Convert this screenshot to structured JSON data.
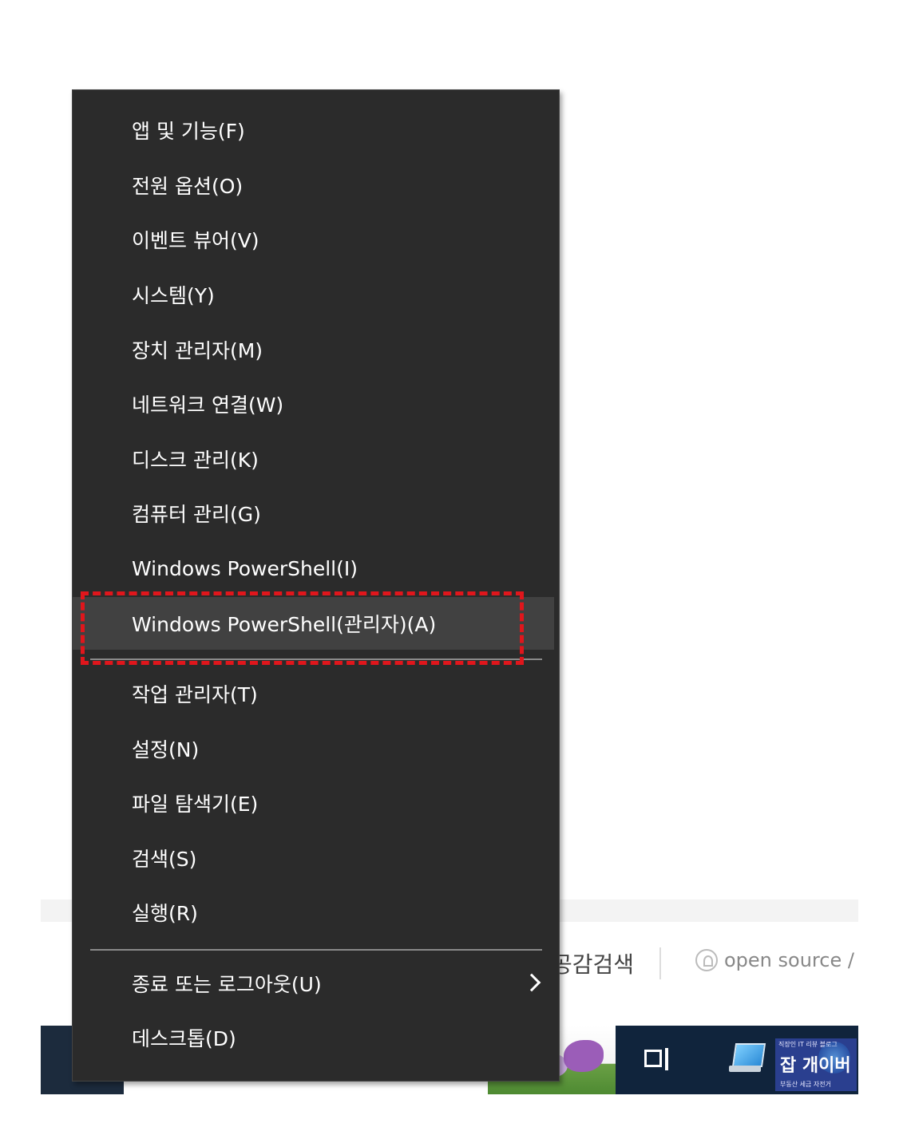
{
  "context_menu": {
    "items": [
      {
        "label": "앱 및 기능(F)"
      },
      {
        "label": "전원 옵션(O)"
      },
      {
        "label": "이벤트 뷰어(V)"
      },
      {
        "label": "시스템(Y)"
      },
      {
        "label": "장치 관리자(M)"
      },
      {
        "label": "네트워크 연결(W)"
      },
      {
        "label": "디스크 관리(K)"
      },
      {
        "label": "컴퓨터 관리(G)"
      },
      {
        "label": "Windows PowerShell(I)"
      },
      {
        "label": "Windows PowerShell(관리자)(A)",
        "highlighted": true
      },
      {
        "label": "작업 관리자(T)"
      },
      {
        "label": "설정(N)"
      },
      {
        "label": "파일 탐색기(E)"
      },
      {
        "label": "검색(S)"
      },
      {
        "label": "실행(R)"
      },
      {
        "label": "종료 또는 로그아웃(U)",
        "has_submenu": true
      },
      {
        "label": "데스크톱(D)"
      }
    ],
    "background_color": "#2b2b2b",
    "highlight_color": "#414141",
    "annotation_color": "#e0161c"
  },
  "background": {
    "search_text": "공감검색",
    "open_source_text": "open source /"
  },
  "taskbar": {
    "badge": {
      "top_text": "직장인 IT 리뷰 블로그",
      "main_text": "잡 개이버",
      "bottom_text": "부동산 세금 자전거"
    }
  }
}
